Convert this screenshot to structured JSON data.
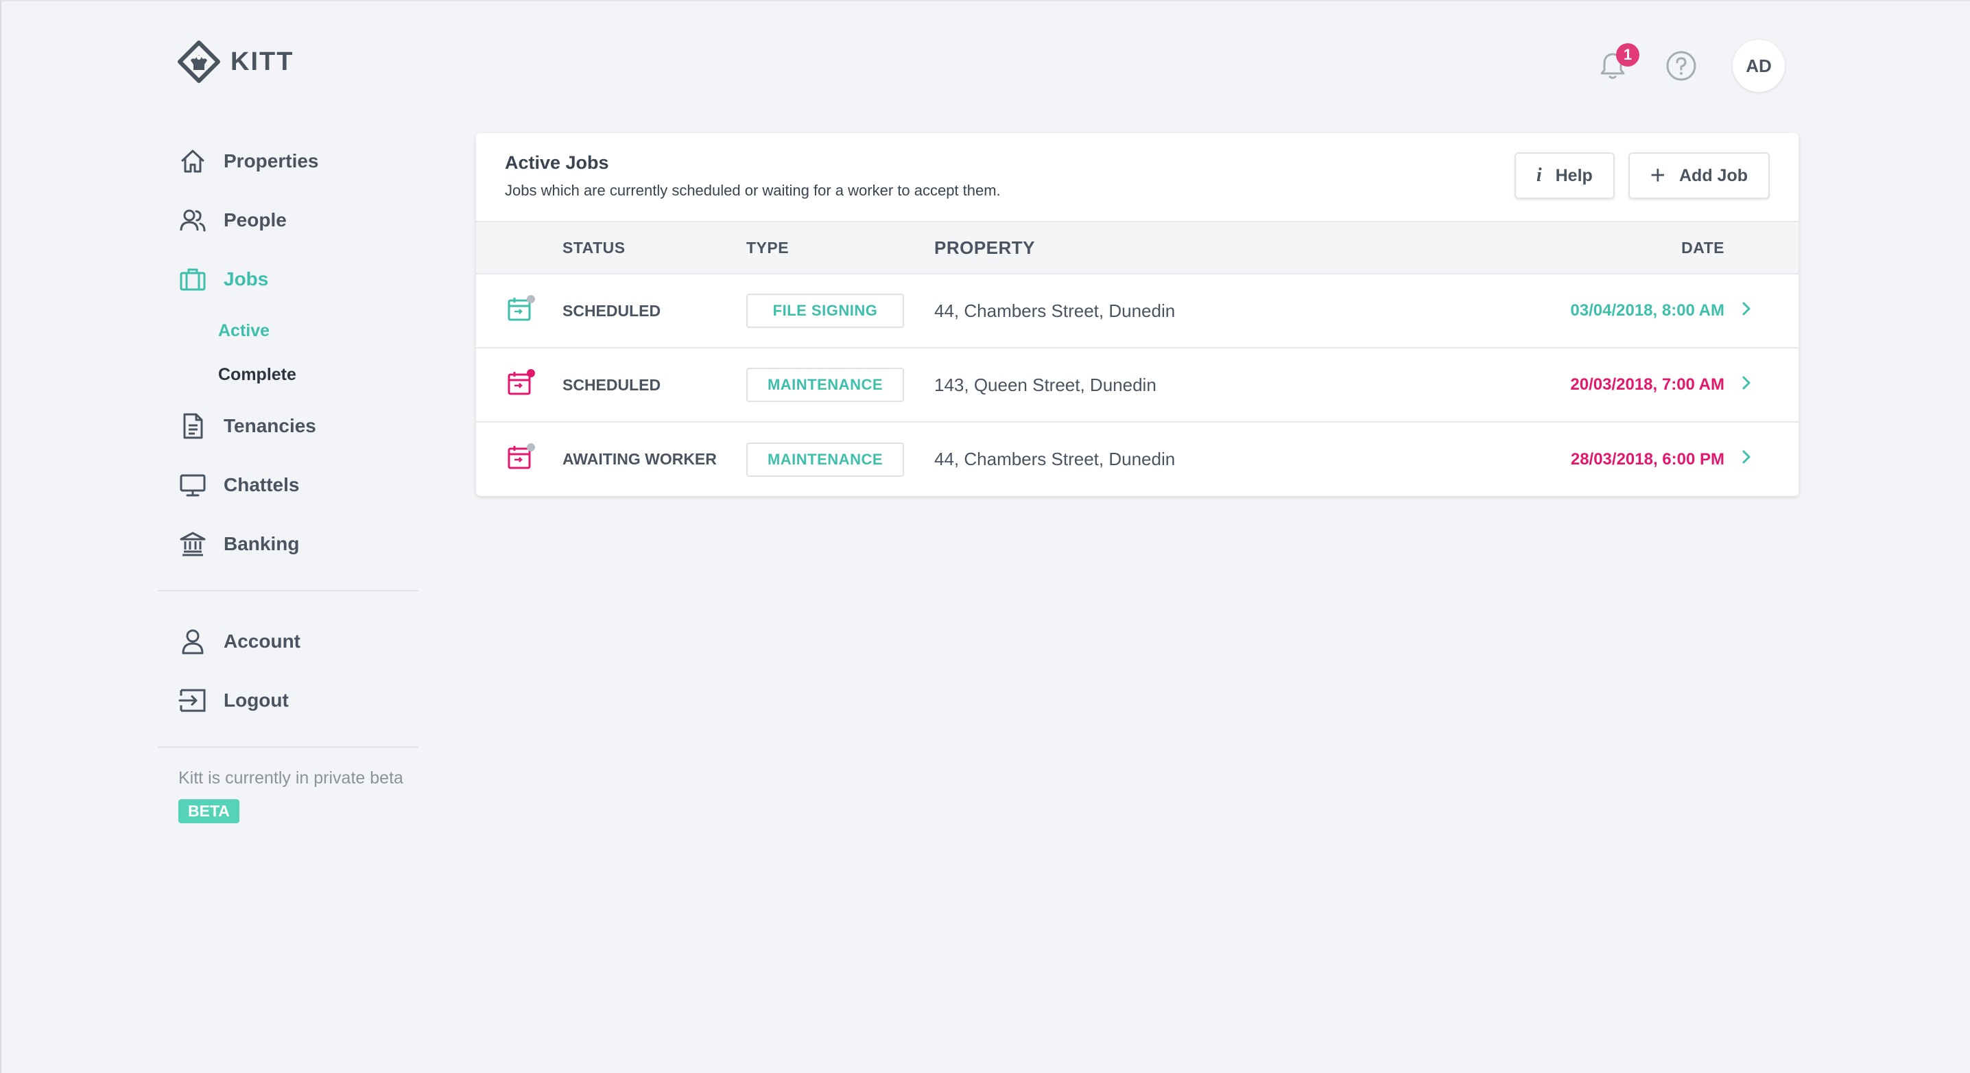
{
  "app": {
    "name": "KITT",
    "avatar_initials": "AD",
    "notification_count": "1"
  },
  "colors": {
    "accent": "#3ebfab",
    "alert": "#e2186f",
    "badge": "#e23a77",
    "beta": "#54d3b8"
  },
  "sidebar": {
    "items": [
      {
        "label": "Properties",
        "icon": "home-icon"
      },
      {
        "label": "People",
        "icon": "people-icon"
      },
      {
        "label": "Jobs",
        "icon": "briefcase-icon",
        "active": true
      },
      {
        "label": "Tenancies",
        "icon": "document-icon"
      },
      {
        "label": "Chattels",
        "icon": "monitor-icon"
      },
      {
        "label": "Banking",
        "icon": "bank-icon"
      }
    ],
    "jobs_sub": [
      {
        "label": "Active",
        "active": true
      },
      {
        "label": "Complete"
      }
    ],
    "account": [
      {
        "label": "Account",
        "icon": "user-icon"
      },
      {
        "label": "Logout",
        "icon": "logout-icon"
      }
    ],
    "beta_text": "Kitt is currently in private beta",
    "beta_badge": "BETA"
  },
  "card": {
    "title": "Active Jobs",
    "subtitle": "Jobs which are currently scheduled or waiting for a worker to accept them.",
    "help_label": "Help",
    "help_icon_glyph": "i",
    "add_label": "Add Job",
    "add_icon_glyph": "+"
  },
  "table": {
    "headers": {
      "status": "STATUS",
      "type": "TYPE",
      "property": "PROPERTY",
      "date": "DATE"
    },
    "rows": [
      {
        "status": "SCHEDULED",
        "type": "FILE SIGNING",
        "property": "44, Chambers Street, Dunedin",
        "date": "03/04/2018, 8:00 AM",
        "date_color": "teal",
        "icon_color": "teal",
        "dot_color": "grey"
      },
      {
        "status": "SCHEDULED",
        "type": "MAINTENANCE",
        "property": "143, Queen Street, Dunedin",
        "date": "20/03/2018, 7:00 AM",
        "date_color": "red",
        "icon_color": "red",
        "dot_color": "red"
      },
      {
        "status": "AWAITING WORKER",
        "type": "MAINTENANCE",
        "property": "44, Chambers Street, Dunedin",
        "date": "28/03/2018, 6:00 PM",
        "date_color": "red",
        "icon_color": "red",
        "dot_color": "grey"
      }
    ]
  }
}
